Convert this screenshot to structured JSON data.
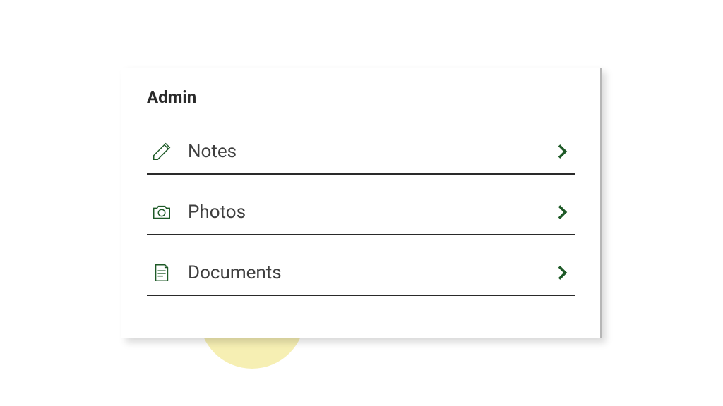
{
  "card": {
    "title": "Admin",
    "items": [
      {
        "icon": "pencil-icon",
        "label": "Notes"
      },
      {
        "icon": "camera-icon",
        "label": "Photos"
      },
      {
        "icon": "document-icon",
        "label": "Documents"
      }
    ]
  },
  "colors": {
    "accent": "#1e5a27",
    "highlight": "#f3e99a"
  }
}
